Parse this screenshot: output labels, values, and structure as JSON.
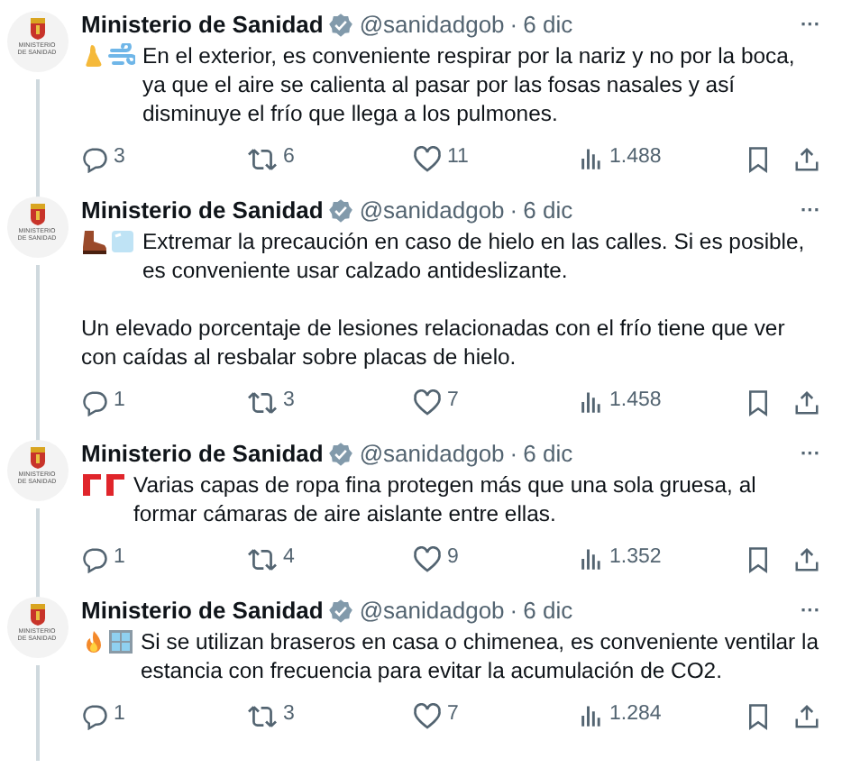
{
  "tweets": [
    {
      "author": "Ministerio de Sanidad",
      "verified": true,
      "avatar_caption": [
        "MINISTERIO",
        "DE SANIDAD"
      ],
      "handle": "@sanidadgob",
      "separator": "·",
      "date": "6 dic",
      "more": "···",
      "paragraphs": [
        "En el exterior, es conveniente respirar por la nariz y no por la boca, ya que el aire se calienta al pasar por las fosas nasales y así disminuye el frío que llega a los pulmones."
      ],
      "replies": "3",
      "reposts": "6",
      "likes": "11",
      "views": "1.488"
    },
    {
      "author": "Ministerio de Sanidad",
      "verified": true,
      "avatar_caption": [
        "MINISTERIO",
        "DE SANIDAD"
      ],
      "handle": "@sanidadgob",
      "separator": "·",
      "date": "6 dic",
      "more": "···",
      "paragraphs": [
        "Extremar la precaución en caso de hielo en las calles. Si es posible, es conveniente usar calzado antideslizante.",
        "Un elevado porcentaje de lesiones relacionadas con el frío tiene que ver con caídas al resbalar sobre placas de hielo."
      ],
      "replies": "1",
      "reposts": "3",
      "likes": "7",
      "views": "1.458"
    },
    {
      "author": "Ministerio de Sanidad",
      "verified": true,
      "avatar_caption": [
        "MINISTERIO",
        "DE SANIDAD"
      ],
      "handle": "@sanidadgob",
      "separator": "·",
      "date": "6 dic",
      "more": "···",
      "paragraphs": [
        "Varias capas de ropa fina protegen más que una sola gruesa, al formar cámaras de aire aislante entre ellas."
      ],
      "replies": "1",
      "reposts": "4",
      "likes": "9",
      "views": "1.352"
    },
    {
      "author": "Ministerio de Sanidad",
      "verified": true,
      "avatar_caption": [
        "MINISTERIO",
        "DE SANIDAD"
      ],
      "handle": "@sanidadgob",
      "separator": "·",
      "date": "6 dic",
      "more": "···",
      "paragraphs": [
        "Si se utilizan braseros en casa o chimenea, es conveniente ventilar la estancia con frecuencia para evitar la acumulación de CO2."
      ],
      "replies": "1",
      "reposts": "3",
      "likes": "7",
      "views": "1.284"
    }
  ]
}
